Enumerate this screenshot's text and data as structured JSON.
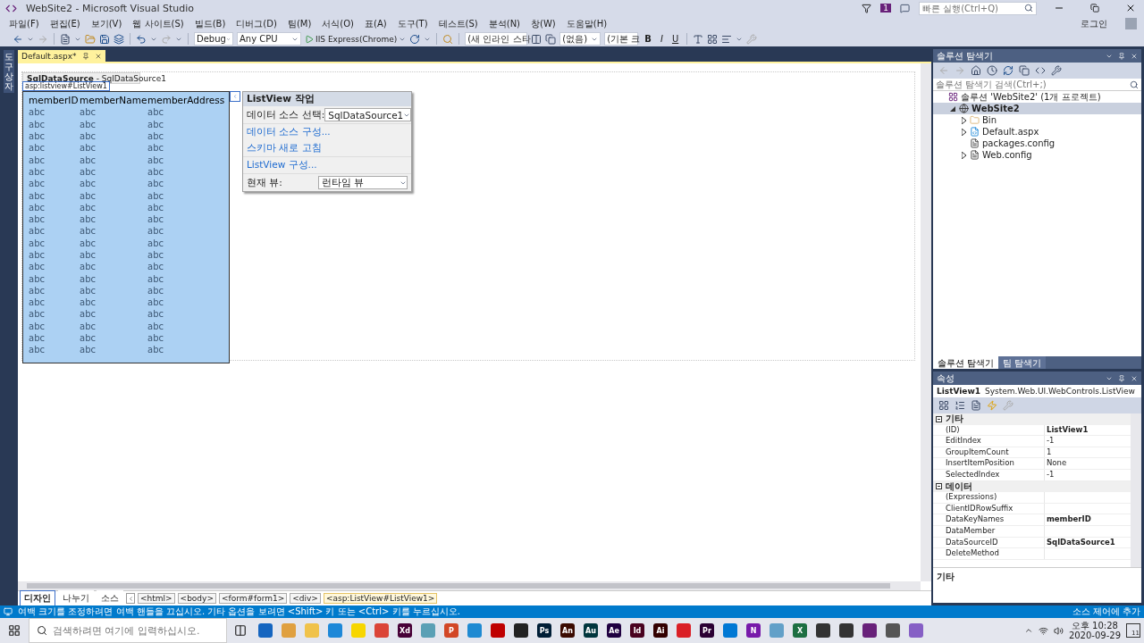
{
  "title_bar": {
    "title": "WebSite2 - Microsoft Visual Studio",
    "notification_count": "1",
    "quick_launch": {
      "placeholder": "빠른 실행(Ctrl+Q)"
    }
  },
  "menu": [
    "파일(F)",
    "편집(E)",
    "보기(V)",
    "웹 사이트(S)",
    "빌드(B)",
    "디버그(D)",
    "팀(M)",
    "서식(O)",
    "표(A)",
    "도구(T)",
    "테스트(S)",
    "분석(N)",
    "창(W)",
    "도움말(H)"
  ],
  "sign_in": "로그인",
  "toolbar": {
    "config": "Debug",
    "platform": "Any CPU",
    "run": "IIS Express(Chrome)",
    "style": "(새 인라인 스타",
    "block": "(없음)",
    "font": "(기본 크",
    "bold": "B",
    "italic": "I",
    "underline": "U"
  },
  "side_strip": "도구 상자",
  "document_tab": {
    "label": "Default.aspx*",
    "selected": true
  },
  "designer": {
    "datasource_caption": "**SqlDataSource** - SqlDataSource1",
    "tag_label": "asp:listview#ListView1",
    "listview": {
      "columns": [
        "memberID",
        "memberName",
        "memberAddress"
      ],
      "rows": [
        [
          "abc",
          "abc",
          "abc"
        ],
        [
          "abc",
          "abc",
          "abc"
        ],
        [
          "abc",
          "abc",
          "abc"
        ],
        [
          "abc",
          "abc",
          "abc"
        ],
        [
          "abc",
          "abc",
          "abc"
        ],
        [
          "abc",
          "abc",
          "abc"
        ],
        [
          "abc",
          "abc",
          "abc"
        ],
        [
          "abc",
          "abc",
          "abc"
        ],
        [
          "abc",
          "abc",
          "abc"
        ],
        [
          "abc",
          "abc",
          "abc"
        ],
        [
          "abc",
          "abc",
          "abc"
        ],
        [
          "abc",
          "abc",
          "abc"
        ],
        [
          "abc",
          "abc",
          "abc"
        ],
        [
          "abc",
          "abc",
          "abc"
        ],
        [
          "abc",
          "abc",
          "abc"
        ],
        [
          "abc",
          "abc",
          "abc"
        ],
        [
          "abc",
          "abc",
          "abc"
        ],
        [
          "abc",
          "abc",
          "abc"
        ],
        [
          "abc",
          "abc",
          "abc"
        ],
        [
          "abc",
          "abc",
          "abc"
        ],
        [
          "abc",
          "abc",
          "abc"
        ]
      ]
    },
    "smart_tag": {
      "title": "ListView 작업",
      "datasource_label": "데이터 소스 선택:",
      "datasource_value": "SqlDataSource1",
      "links": [
        "데이터 소스 구성...",
        "스키마 새로 고침"
      ],
      "configure_link": "ListView 구성...",
      "view_label": "현재 뷰:",
      "view_value": "런타임 뷰"
    }
  },
  "view_tabs": [
    {
      "label": "디자인",
      "selected": true
    },
    {
      "label": "나누기",
      "selected": false
    },
    {
      "label": "소스",
      "selected": false
    }
  ],
  "breadcrumb": [
    {
      "label": "<html>",
      "selected": false
    },
    {
      "label": "<body>",
      "selected": false
    },
    {
      "label": "<form#form1>",
      "selected": false
    },
    {
      "label": "<div>",
      "selected": false
    },
    {
      "label": "<asp:ListView#ListView1>",
      "selected": true
    }
  ],
  "solution_explorer": {
    "title": "솔루션 탐색기",
    "search": {
      "placeholder": "솔루션 탐색기 검색(Ctrl+;)"
    },
    "tree": [
      {
        "label": "솔루션 'WebSite2' (1개 프로젝트)",
        "kind": "solution",
        "selected": false,
        "children": [
          {
            "label": "WebSite2",
            "kind": "website",
            "expanded": true,
            "selected": true,
            "children": [
              {
                "label": "Bin",
                "kind": "folder",
                "expanded": false,
                "selected": false
              },
              {
                "label": "Default.aspx",
                "kind": "page",
                "expanded": false,
                "selected": false
              },
              {
                "label": "packages.config",
                "kind": "config",
                "selected": false
              },
              {
                "label": "Web.config",
                "kind": "config",
                "expanded": false,
                "selected": false
              }
            ]
          }
        ]
      }
    ],
    "tabs": [
      {
        "label": "솔루션 탐색기",
        "selected": true
      },
      {
        "label": "팀 탐색기",
        "selected": false
      }
    ]
  },
  "properties": {
    "title": "속성",
    "object_name": "ListView1",
    "object_type": "System.Web.UI.WebControls.ListView",
    "categories": [
      {
        "name": "기타",
        "expanded": true,
        "items": [
          {
            "name": "(ID)",
            "value": "ListView1",
            "bold": true
          },
          {
            "name": "EditIndex",
            "value": "-1",
            "bold": false
          },
          {
            "name": "GroupItemCount",
            "value": "1",
            "bold": false
          },
          {
            "name": "InsertItemPosition",
            "value": "None",
            "bold": false
          },
          {
            "name": "SelectedIndex",
            "value": "-1",
            "bold": false
          }
        ]
      },
      {
        "name": "데이터",
        "expanded": true,
        "items": [
          {
            "name": "(Expressions)",
            "bold": false
          },
          {
            "name": "ClientIDRowSuffix",
            "bold": false
          },
          {
            "name": "DataKeyNames",
            "value": "memberID",
            "bold": true
          },
          {
            "name": "DataMember",
            "bold": false
          },
          {
            "name": "DataSourceID",
            "value": "SqlDataSource1",
            "bold": true
          },
          {
            "name": "DeleteMethod",
            "bold": false
          }
        ]
      }
    ],
    "description_title": "기타"
  },
  "status_bar": {
    "message": "여백 크기를 조정하려면 여백 핸들을 끄십시오. 기타 옵션을 보려면 <Shift> 키 또는 <Ctrl> 키를 누르십시오.",
    "source_control": "소스 제어에 추가"
  },
  "taskbar": {
    "search": {
      "placeholder": "검색하려면 여기에 입력하십시오."
    },
    "apps": [
      {
        "color": "#1565c0"
      },
      {
        "color": "#e0a040"
      },
      {
        "color": "#f0c24a"
      },
      {
        "color": "#1e88d8"
      },
      {
        "color": "#f7d600"
      },
      {
        "color": "#db4437"
      },
      {
        "color": "#470137",
        "label": "Xd"
      },
      {
        "color": "#5aa0b5"
      },
      {
        "color": "#d24726",
        "label": "P"
      },
      {
        "color": "#1f8ad2"
      },
      {
        "color": "#bf0000"
      },
      {
        "color": "#222222"
      },
      {
        "color": "#001e36",
        "label": "Ps"
      },
      {
        "color": "#3b0a00",
        "label": "An"
      },
      {
        "color": "#00363d",
        "label": "Au"
      },
      {
        "color": "#1f0040",
        "label": "Ae"
      },
      {
        "color": "#49021f",
        "label": "Id"
      },
      {
        "color": "#330000",
        "label": "Ai"
      },
      {
        "color": "#da1f26"
      },
      {
        "color": "#2a0033",
        "label": "Pr"
      },
      {
        "color": "#0078d4"
      },
      {
        "color": "#7719aa",
        "label": "N"
      },
      {
        "color": "#62a0c8"
      },
      {
        "color": "#1d6f42",
        "label": "X"
      },
      {
        "color": "#333333"
      },
      {
        "color": "#333333"
      },
      {
        "color": "#68217a"
      },
      {
        "color": "#555555"
      },
      {
        "color": "#865fc5"
      }
    ],
    "time": "오후 10:28",
    "date": "2020-09-29",
    "notifications": "11"
  }
}
